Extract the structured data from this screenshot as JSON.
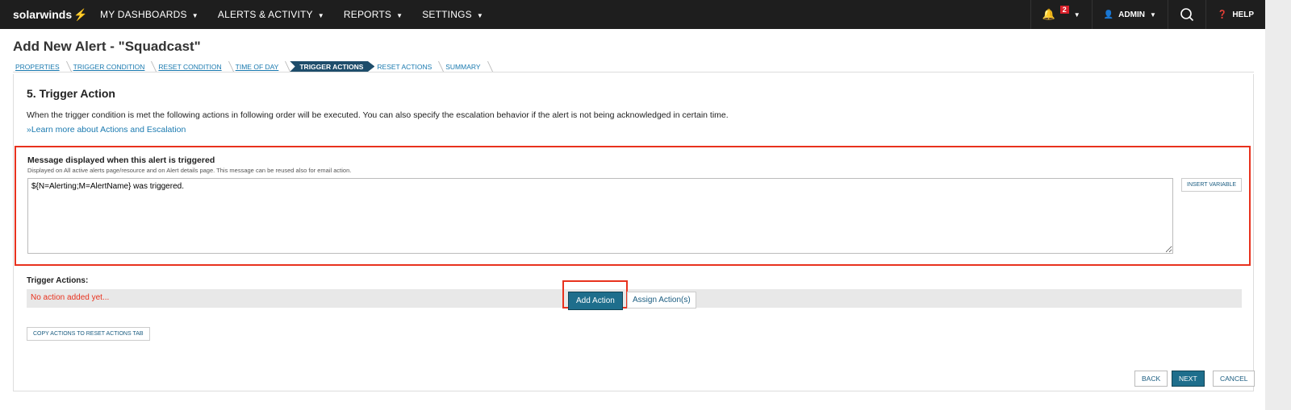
{
  "nav": {
    "brand": "solarwinds",
    "menus": [
      "MY DASHBOARDS",
      "ALERTS & ACTIVITY",
      "REPORTS",
      "SETTINGS"
    ],
    "notifications": "2",
    "user": "ADMIN",
    "help": "HELP"
  },
  "title": "Add New Alert - \"Squadcast\"",
  "wizard": [
    "PROPERTIES",
    "TRIGGER CONDITION",
    "RESET CONDITION",
    "TIME OF DAY",
    "TRIGGER ACTIONS",
    "RESET ACTIONS",
    "SUMMARY"
  ],
  "section": {
    "heading": "5. Trigger Action",
    "description": "When the trigger condition is met the following actions in following order will be executed. You can also specify the escalation behavior if the alert is not being acknowledged in certain time.",
    "learn_link": "»Learn more about Actions and Escalation"
  },
  "message": {
    "label": "Message displayed when this alert is triggered",
    "sublabel": "Displayed on All active alerts page/resource and on Alert details page. This message can be reused also for email action.",
    "value": "${N=Alerting;M=AlertName} was triggered.",
    "insert_variable": "INSERT VARIABLE"
  },
  "actions": {
    "label": "Trigger Actions:",
    "empty": "No action added yet...",
    "add": "Add Action",
    "assign": "Assign Action(s)",
    "copy": "COPY ACTIONS TO RESET ACTIONS TAB"
  },
  "footer": {
    "back": "BACK",
    "next": "NEXT",
    "cancel": "CANCEL"
  }
}
